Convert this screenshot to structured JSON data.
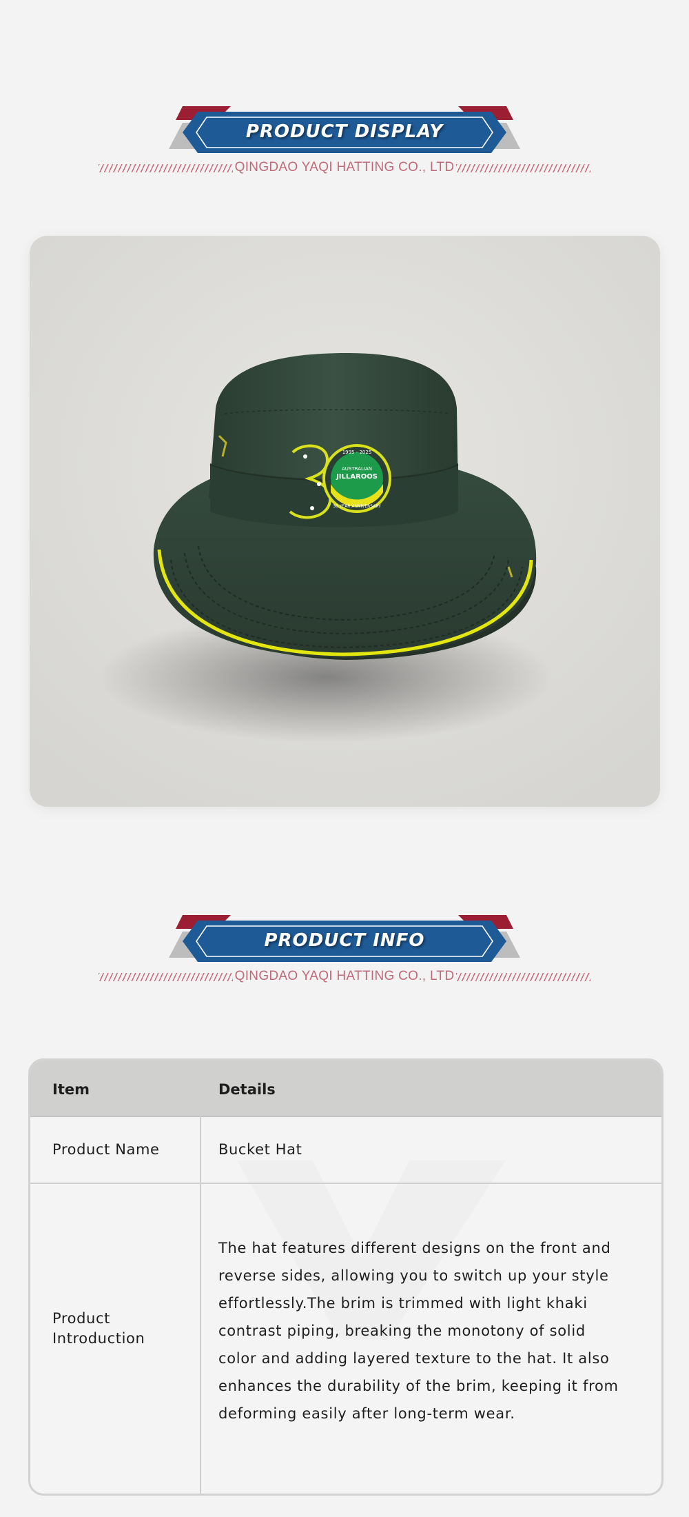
{
  "sections": {
    "display": {
      "title": "PRODUCT DISPLAY",
      "subtitle": "QINGDAO YAQI HATTING CO., LTD"
    },
    "info": {
      "title": "PRODUCT INFO",
      "subtitle": "QINGDAO YAQI HATTING CO., LTD"
    }
  },
  "product_photo": {
    "logo_number": "30",
    "logo_badge_top": "1995 - 2025",
    "logo_badge_line1": "AUSTRALIAN",
    "logo_badge_line2": "JILLAROOS",
    "logo_badge_bottom": "30 YEAR ANNIVERSARY"
  },
  "table": {
    "headers": [
      "Item",
      "Details"
    ],
    "rows": [
      {
        "label": "Product Name",
        "value": "Bucket Hat"
      },
      {
        "label_line1": "Product",
        "label_line2": "Introduction"
      }
    ],
    "intro_lines": [
      "The hat features different designs on the front and",
      "reverse sides, allowing you to switch up your style",
      "effortlessly.The brim is trimmed with light khaki",
      "contrast piping, breaking the monotony of solid",
      "color and adding layered texture to the hat. It also",
      "enhances the durability of the brim, keeping it from",
      "deforming easily after long-term wear."
    ]
  },
  "colors": {
    "banner_blue": "#1e5a96",
    "banner_red": "#9b1e33",
    "banner_grey": "#bdbdbd",
    "accent_pink": "#c06a78",
    "hat_green": "#2f4437",
    "piping_yellow": "#e3e70f"
  }
}
